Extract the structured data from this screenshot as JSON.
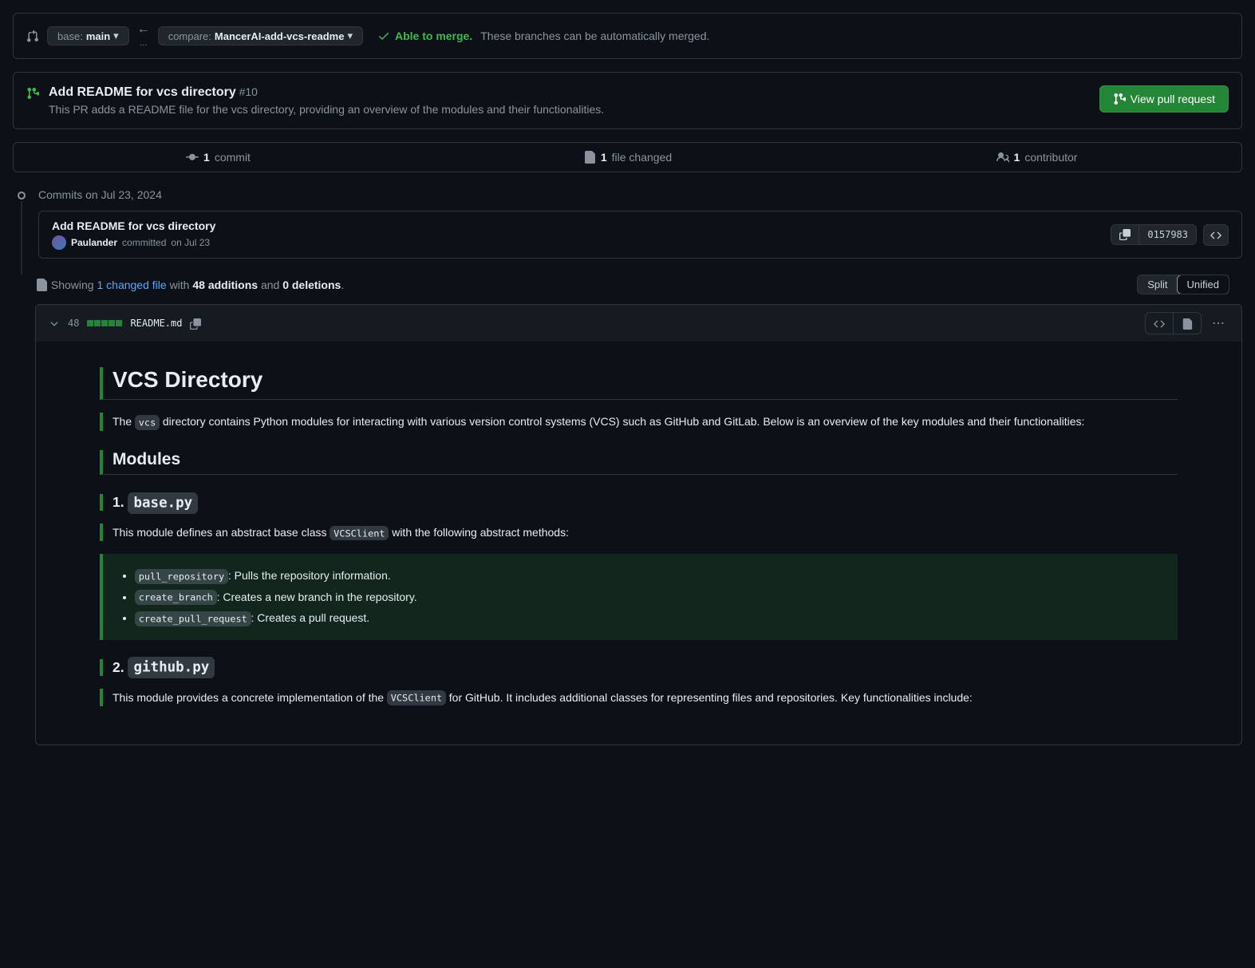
{
  "compare": {
    "base_label": "base:",
    "base_value": "main",
    "compare_label": "compare:",
    "compare_value": "MancerAI-add-vcs-readme",
    "merge_ok": "Able to merge.",
    "merge_text": "These branches can be automatically merged."
  },
  "pr": {
    "title": "Add README for vcs directory",
    "number": "#10",
    "description": "This PR adds a README file for the vcs directory, providing an overview of the modules and their functionalities.",
    "view_btn": "View pull request"
  },
  "stats": {
    "commits_n": "1",
    "commits_label": "commit",
    "files_n": "1",
    "files_label": "file changed",
    "contributors_n": "1",
    "contributors_label": "contributor"
  },
  "timeline": {
    "date_header": "Commits on Jul 23, 2024",
    "commit_title": "Add README for vcs directory",
    "author": "Paulander",
    "committed": "committed",
    "when": "on Jul 23",
    "sha": "0157983"
  },
  "diff": {
    "showing": "Showing",
    "changed_files": "1 changed file",
    "with": "with",
    "additions": "48 additions",
    "and": "and",
    "deletions": "0 deletions",
    "period": ".",
    "split": "Split",
    "unified": "Unified"
  },
  "file": {
    "linecount": "48",
    "name": "README.md"
  },
  "readme": {
    "h1": "VCS Directory",
    "intro_pre": "The ",
    "intro_code": "vcs",
    "intro_post": " directory contains Python modules for interacting with various version control systems (VCS) such as GitHub and GitLab. Below is an overview of the key modules and their functionalities:",
    "h2_modules": "Modules",
    "m1_title_pre": "1. ",
    "m1_title_code": "base.py",
    "m1_desc_pre": "This module defines an abstract base class ",
    "m1_desc_code": "VCSClient",
    "m1_desc_post": " with the following abstract methods:",
    "m1_items": [
      {
        "code": "pull_repository",
        "text": ": Pulls the repository information."
      },
      {
        "code": "create_branch",
        "text": ": Creates a new branch in the repository."
      },
      {
        "code": "create_pull_request",
        "text": ": Creates a pull request."
      }
    ],
    "m2_title_pre": "2. ",
    "m2_title_code": "github.py",
    "m2_desc_pre": "This module provides a concrete implementation of the ",
    "m2_desc_code": "VCSClient",
    "m2_desc_post": " for GitHub. It includes additional classes for representing files and repositories. Key functionalities include:"
  }
}
